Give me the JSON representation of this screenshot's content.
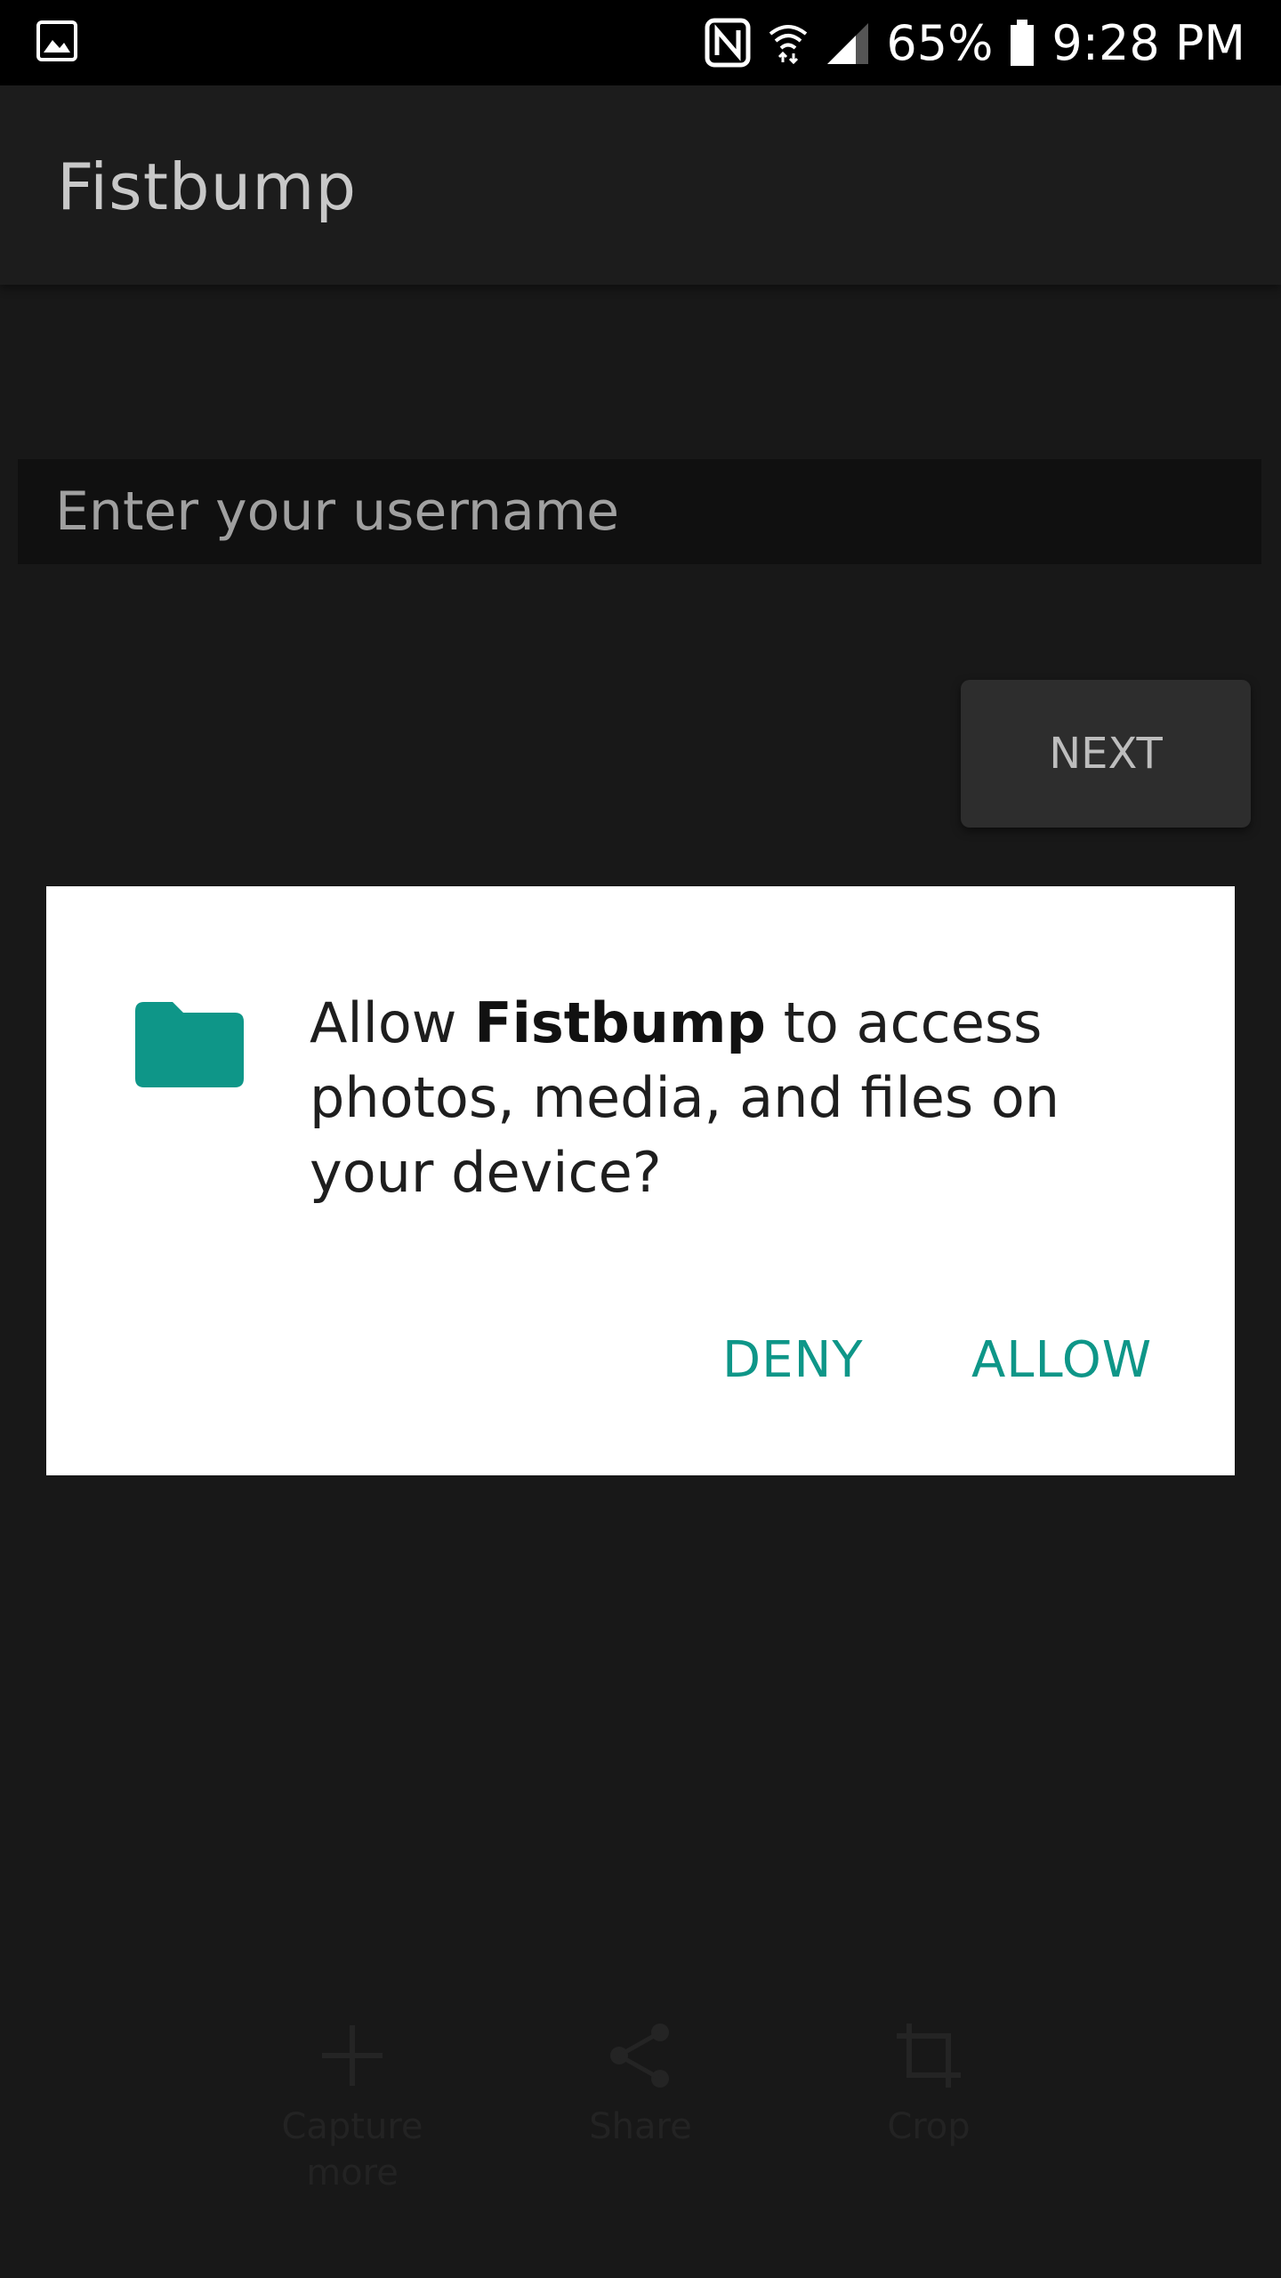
{
  "status_bar": {
    "left_icon": "gallery-icon",
    "icons": [
      "nfc-icon",
      "wifi-icon",
      "signal-icon",
      "battery-icon"
    ],
    "battery": "65%",
    "time": "9:28 PM"
  },
  "app": {
    "title": "Fistbump"
  },
  "form": {
    "username_placeholder": "Enter your username",
    "next_label": "NEXT"
  },
  "dialog": {
    "icon": "folder-icon",
    "message_prefix": "Allow ",
    "app_name": "Fistbump",
    "message_suffix": " to access photos, media, and files on your device?",
    "deny_label": "DENY",
    "allow_label": "ALLOW"
  },
  "toolbar": {
    "items": [
      {
        "label": "Capture more",
        "icon": "plus-icon"
      },
      {
        "label": "Share",
        "icon": "share-icon"
      },
      {
        "label": "Crop",
        "icon": "crop-icon"
      }
    ]
  },
  "colors": {
    "accent": "#0E9688",
    "background": "#181818",
    "dialog_background": "#FFFFFF"
  }
}
